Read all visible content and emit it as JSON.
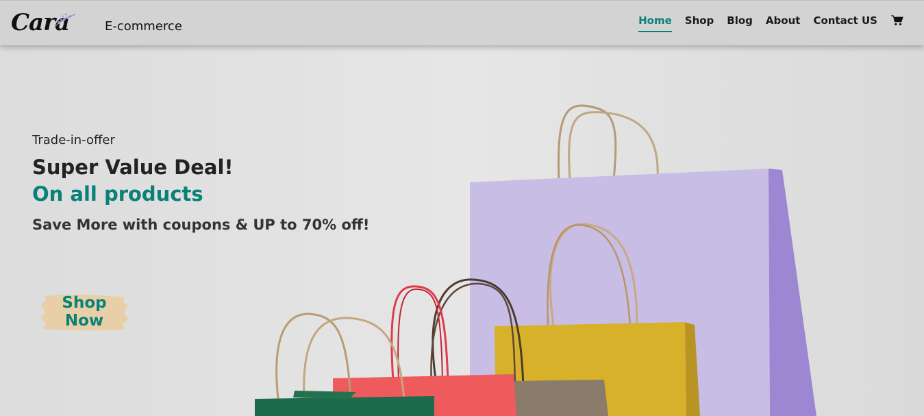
{
  "header": {
    "logo_text": "Cara",
    "brand_subtitle": "E-commerce",
    "nav": [
      {
        "label": "Home",
        "active": true
      },
      {
        "label": "Shop",
        "active": false
      },
      {
        "label": "Blog",
        "active": false
      },
      {
        "label": "About",
        "active": false
      },
      {
        "label": "Contact US",
        "active": false
      }
    ],
    "cart_icon": "shopping-cart-icon"
  },
  "hero": {
    "eyebrow": "Trade-in-offer",
    "headline": "Super Value Deal!",
    "highlight": "On all products",
    "tagline": "Save More with coupons & UP to 70% off!",
    "cta_label": "Shop Now"
  },
  "colors": {
    "accent": "#088178",
    "header_bg": "#d3d3d3",
    "button_brush": "#e8cfa8"
  }
}
